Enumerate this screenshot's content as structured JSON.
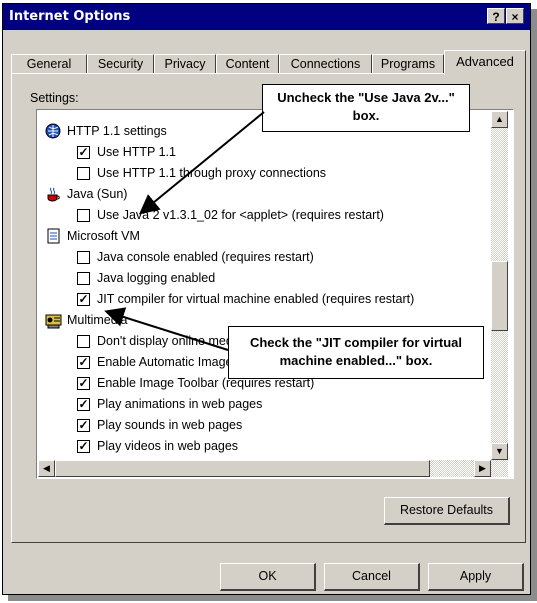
{
  "window": {
    "title": "Internet Options",
    "help_label": "?",
    "close_label": "×"
  },
  "tabs": [
    {
      "label": "General"
    },
    {
      "label": "Security"
    },
    {
      "label": "Privacy"
    },
    {
      "label": "Content"
    },
    {
      "label": "Connections"
    },
    {
      "label": "Programs"
    },
    {
      "label": "Advanced",
      "active": true
    }
  ],
  "settings_label": "Settings:",
  "settings_list": [
    {
      "type": "category",
      "label": "HTTP 1.1 settings",
      "icon": "globe-settings-icon"
    },
    {
      "type": "option",
      "label": "Use HTTP 1.1",
      "checked": true
    },
    {
      "type": "option",
      "label": "Use HTTP 1.1 through proxy connections",
      "checked": false
    },
    {
      "type": "category",
      "label": "Java (Sun)",
      "icon": "java-cup-icon"
    },
    {
      "type": "option",
      "label": "Use Java 2 v1.3.1_02 for <applet> (requires restart)",
      "checked": false
    },
    {
      "type": "category",
      "label": "Microsoft VM",
      "icon": "document-icon"
    },
    {
      "type": "option",
      "label": "Java console enabled (requires restart)",
      "checked": false
    },
    {
      "type": "option",
      "label": "Java logging enabled",
      "checked": false
    },
    {
      "type": "option",
      "label": "JIT compiler for virtual machine enabled (requires restart)",
      "checked": true
    },
    {
      "type": "category",
      "label": "Multimedia",
      "icon": "multimedia-icon"
    },
    {
      "type": "option",
      "label": "Don't display online media content in the media bar",
      "checked": false
    },
    {
      "type": "option",
      "label": "Enable Automatic Image Resizing",
      "checked": true
    },
    {
      "type": "option",
      "label": "Enable Image Toolbar (requires restart)",
      "checked": true
    },
    {
      "type": "option",
      "label": "Play animations in web pages",
      "checked": true
    },
    {
      "type": "option",
      "label": "Play sounds in web pages",
      "checked": true
    },
    {
      "type": "option",
      "label": "Play videos in web pages",
      "checked": true
    }
  ],
  "restore_defaults_label": "Restore Defaults",
  "footer": {
    "ok_label": "OK",
    "cancel_label": "Cancel",
    "apply_label": "Apply"
  },
  "callouts": {
    "uncheck_java": "Uncheck the \"Use Java 2v...\" box.",
    "check_jit": "Check the \"JIT compiler for virtual machine enabled...\" box."
  },
  "colors": {
    "titlebar": "#000080",
    "dialog_face": "#d4d0c8"
  }
}
